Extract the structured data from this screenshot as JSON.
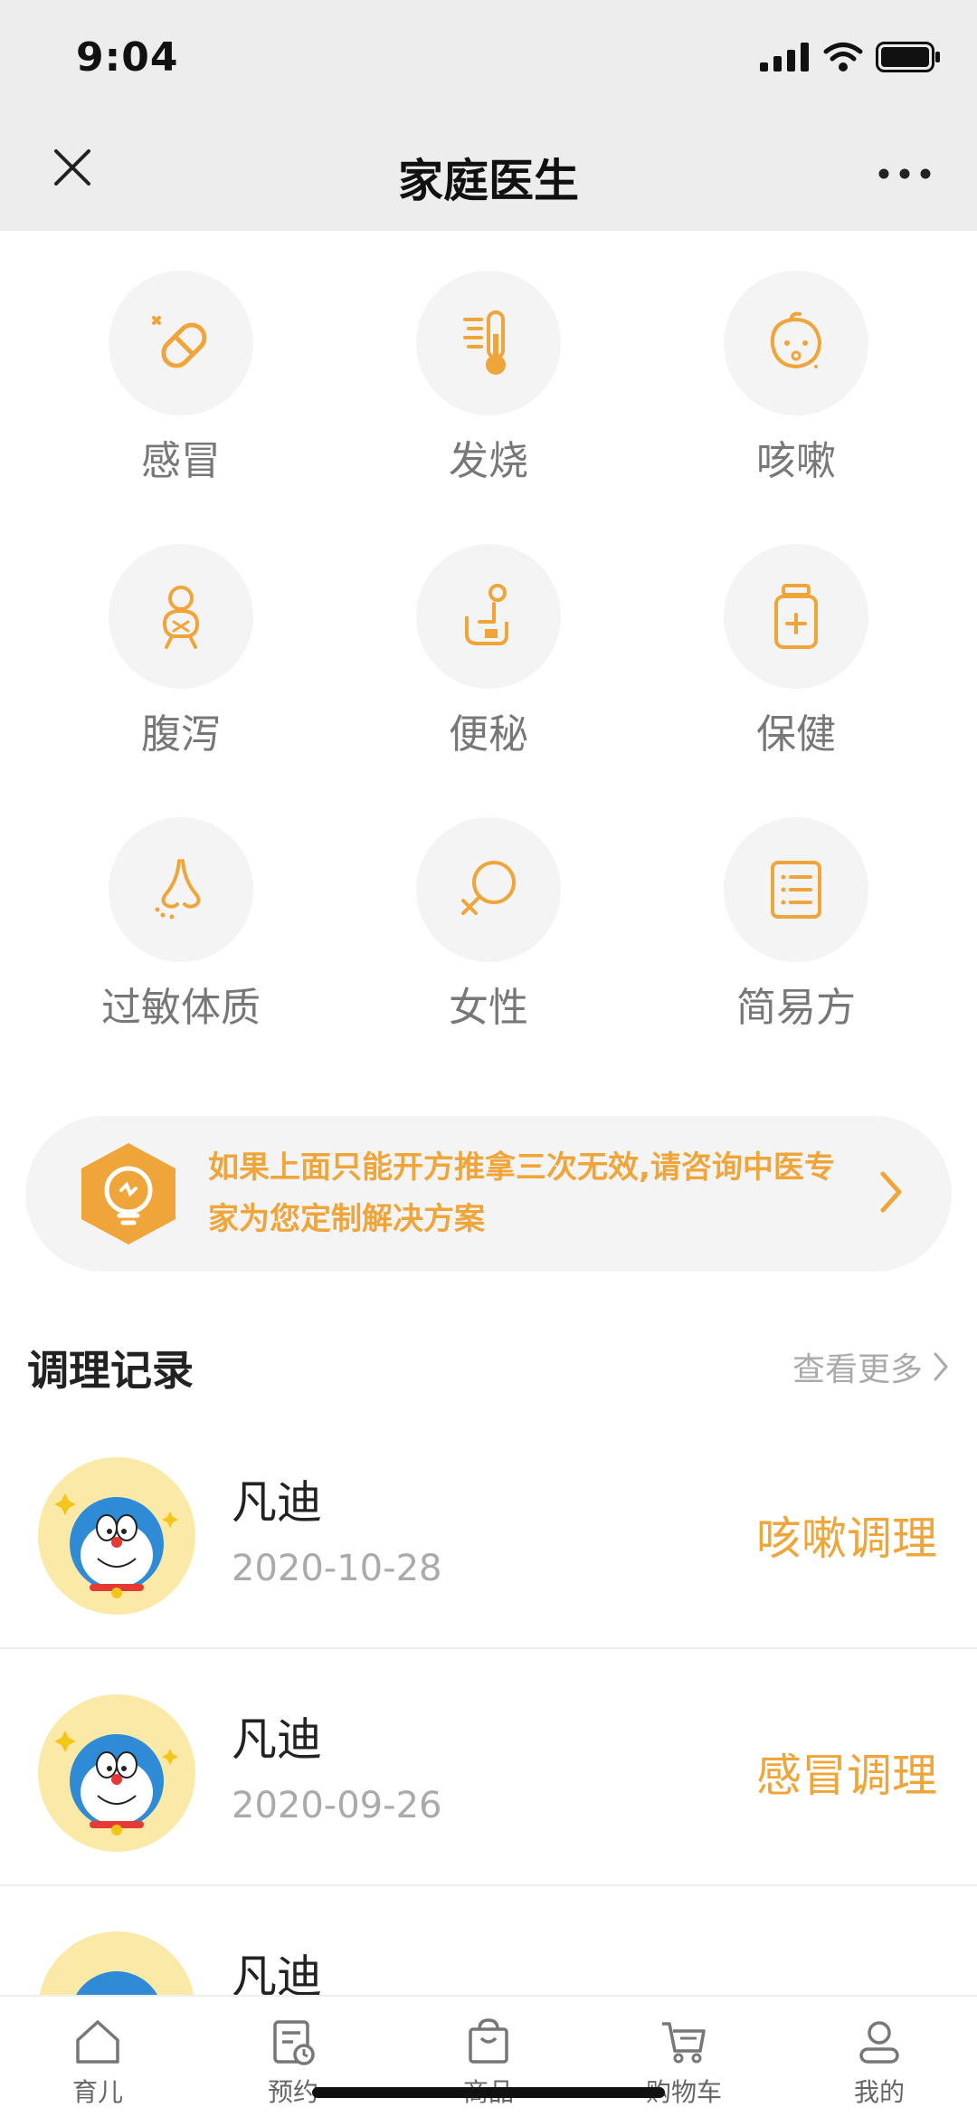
{
  "status_bar": {
    "time": "9:04"
  },
  "header": {
    "title": "家庭医生"
  },
  "categories": [
    {
      "label": "感冒",
      "icon": "pill-icon"
    },
    {
      "label": "发烧",
      "icon": "thermometer-icon"
    },
    {
      "label": "咳嗽",
      "icon": "baby-cough-icon"
    },
    {
      "label": "腹泻",
      "icon": "baby-body-icon"
    },
    {
      "label": "便秘",
      "icon": "toilet-person-icon"
    },
    {
      "label": "保健",
      "icon": "medicine-bottle-icon"
    },
    {
      "label": "过敏体质",
      "icon": "nose-icon"
    },
    {
      "label": "女性",
      "icon": "female-symbol-icon"
    },
    {
      "label": "简易方",
      "icon": "prescription-list-icon"
    }
  ],
  "banner": {
    "text": "如果上面只能开方推拿三次无效,请咨询中医专家为您定制解决方案"
  },
  "records_section": {
    "title": "调理记录",
    "more_label": "查看更多"
  },
  "records": [
    {
      "name": "凡迪",
      "date": "2020-10-28",
      "type": "咳嗽调理"
    },
    {
      "name": "凡迪",
      "date": "2020-09-26",
      "type": "感冒调理"
    },
    {
      "name": "凡迪",
      "date": "",
      "type": ""
    }
  ],
  "tabbar": {
    "items": [
      {
        "label": "育儿",
        "icon": "home-icon"
      },
      {
        "label": "预约",
        "icon": "appointment-icon"
      },
      {
        "label": "商品",
        "icon": "shopping-bag-icon"
      },
      {
        "label": "购物车",
        "icon": "cart-icon"
      },
      {
        "label": "我的",
        "icon": "user-icon"
      }
    ]
  },
  "colors": {
    "accent": "#f0a53a",
    "header_bg": "#ededed",
    "circle_bg": "#f4f4f4"
  }
}
